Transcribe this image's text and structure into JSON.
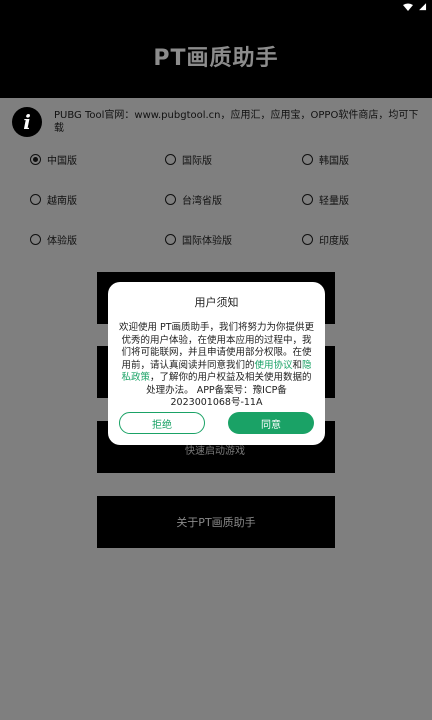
{
  "app": {
    "title": "PT画质助手"
  },
  "info": {
    "text": "PUBG Tool官网：www.pubgtool.cn，应用汇，应用宝，OPPO软件商店，均可下载"
  },
  "versions": {
    "rows": [
      [
        {
          "label": "中国版",
          "selected": true
        },
        {
          "label": "国际版",
          "selected": false
        },
        {
          "label": "韩国版",
          "selected": false
        }
      ],
      [
        {
          "label": "越南版",
          "selected": false
        },
        {
          "label": "台湾省版",
          "selected": false
        },
        {
          "label": "轻量版",
          "selected": false
        }
      ],
      [
        {
          "label": "体验版",
          "selected": false
        },
        {
          "label": "国际体验版",
          "selected": false
        },
        {
          "label": "印度版",
          "selected": false
        }
      ]
    ]
  },
  "main_buttons": {
    "partial_label": "快速启动游戏",
    "about": "关于PT画质助手"
  },
  "dialog": {
    "title": "用户须知",
    "body_part1": "欢迎使用 PT画质助手，我们将努力为你提供更优秀的用户体验，在使用本应用的过程中，我们将可能联网，并且申请使用部分权限。在使用前，请认真阅读并同意我们的",
    "link_agreement": "使用协议",
    "body_and": "和",
    "link_privacy": "隐私政策",
    "body_part2": "，了解你的用户权益及相关使用数据的处理办法。 APP备案号：豫ICP备2023001068号-11A",
    "refuse": "拒绝",
    "agree": "同意"
  }
}
